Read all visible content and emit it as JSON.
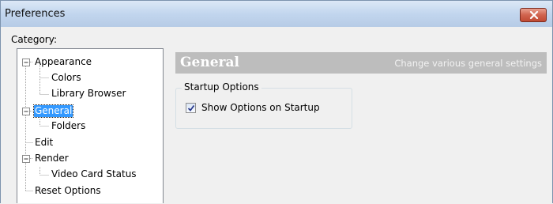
{
  "window": {
    "title": "Preferences",
    "close_icon": "close-x-icon"
  },
  "category_label": "Category:",
  "tree": {
    "items": [
      {
        "label": "Appearance",
        "expanded": true
      },
      {
        "label": "Colors"
      },
      {
        "label": "Library Browser"
      },
      {
        "label": "General",
        "expanded": true,
        "selected": true
      },
      {
        "label": "Folders"
      },
      {
        "label": "Edit"
      },
      {
        "label": "Render",
        "expanded": true
      },
      {
        "label": "Video Card Status"
      },
      {
        "label": "Reset Options"
      }
    ]
  },
  "panel": {
    "title": "General",
    "subtitle": "Change various general settings"
  },
  "startup": {
    "group_label": "Startup Options",
    "show_options_label": "Show Options on Startup",
    "show_options_checked": true
  },
  "colors": {
    "selection": "#3399ff",
    "banner": "#bdbdbd",
    "close_button": "#c75c46"
  }
}
